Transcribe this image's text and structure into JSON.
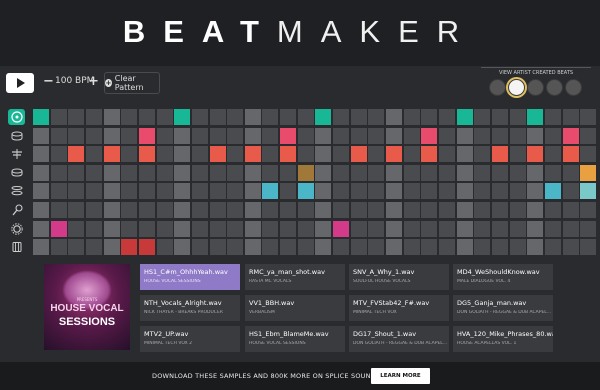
{
  "header": {
    "logo_bold": "BEAT",
    "logo_light": "MAKER"
  },
  "toolbar": {
    "bpm_label": "100 BPM",
    "minus_label": "−",
    "plus_label": "+",
    "clear_label": "Clear Pattern",
    "clear_icon": "+"
  },
  "artists": {
    "label": "VIEW ARTIST CREATED BEATS",
    "count": 5,
    "selected_index": 1
  },
  "sequencer": {
    "steps": 32,
    "beat_every": 4,
    "instruments": [
      {
        "name": "kick-icon",
        "selected": true,
        "color": "#18b896"
      },
      {
        "name": "snare-icon",
        "selected": false,
        "color": "#e84b6c"
      },
      {
        "name": "hihat-icon",
        "selected": false,
        "color": "#e85a4a"
      },
      {
        "name": "tom-icon",
        "selected": false,
        "color": "#a0783a"
      },
      {
        "name": "cymbal-icon",
        "selected": false,
        "color": "#4ab6c8"
      },
      {
        "name": "maraca-icon",
        "selected": false,
        "color": "#e8a040"
      },
      {
        "name": "gear-icon",
        "selected": false,
        "color": "#d43a8a"
      },
      {
        "name": "cabasa-icon",
        "selected": false,
        "color": "#c83a3a"
      }
    ],
    "active": [
      [
        0,
        8,
        16,
        24,
        28
      ],
      [
        6,
        14,
        22,
        30
      ],
      [
        2,
        4,
        6,
        10,
        12,
        14,
        18,
        20,
        22,
        26,
        28,
        30
      ],
      [
        15,
        31
      ],
      [
        13,
        15,
        29,
        31
      ],
      [],
      [
        1,
        17
      ],
      [
        5,
        6
      ]
    ],
    "row_colors": [
      "#18b896",
      "#e84b6c",
      "#e85a4a",
      "#a0783a",
      "#4ab6c8",
      "#e8a040",
      "#d43a8a",
      "#c83a3a"
    ],
    "cell_colors": {
      "3": {
        "15": "#a0783a",
        "31": "#e8a040"
      },
      "4": {
        "13": "#4ab6c8",
        "15": "#4ab6c8",
        "29": "#4ab6c8",
        "31": "#7ac8c8"
      }
    }
  },
  "album": {
    "top_text": "PRESENTS",
    "line1": "HOUSE VOCAL",
    "line2": "SESSIONS"
  },
  "samples": [
    {
      "name": "HS1_C#m_OhhhYeah.wav",
      "pack": "HOUSE VOCAL SESSIONS",
      "active": true
    },
    {
      "name": "RMC_ya_man_shot.wav",
      "pack": "RASTA MC VOCALS",
      "active": false
    },
    {
      "name": "SNV_A_Why_1.wav",
      "pack": "SOULFUL HOUSE VOCALS",
      "active": false
    },
    {
      "name": "MD4_WeShouldKnow.wav",
      "pack": "MALE DIALOGUE VOL. 4",
      "active": false
    },
    {
      "name": "NTH_Vocals_Alright.wav",
      "pack": "NICK THAYER - BREAKS PRODUCER",
      "active": false
    },
    {
      "name": "VV1_BBH.wav",
      "pack": "VERBALISM",
      "active": false
    },
    {
      "name": "MTV_FVStab42_F#.wav",
      "pack": "MINIMAL TECH VOX",
      "active": false
    },
    {
      "name": "DG5_Ganja_man.wav",
      "pack": "DON GOLIATH - REGGAE & DUB ACAPEL...",
      "active": false
    },
    {
      "name": "MTV2_UP.wav",
      "pack": "MINIMAL TECH VOX 2",
      "active": false
    },
    {
      "name": "HS1_Ebm_BlameMe.wav",
      "pack": "HOUSE VOCAL SESSIONS",
      "active": false
    },
    {
      "name": "DG17_Shout_1.wav",
      "pack": "DON GOLIATH - REGGAE & DUB ACAPEL...",
      "active": false
    },
    {
      "name": "HVA_120_Mike_Phrases_80.wav",
      "pack": "HOUSE ACAPELLAS VOL. 1",
      "active": false
    }
  ],
  "footer": {
    "text": "DOWNLOAD THESE SAMPLES AND 800K MORE ON SPLICE SOUNDS",
    "button": "LEARN MORE"
  }
}
